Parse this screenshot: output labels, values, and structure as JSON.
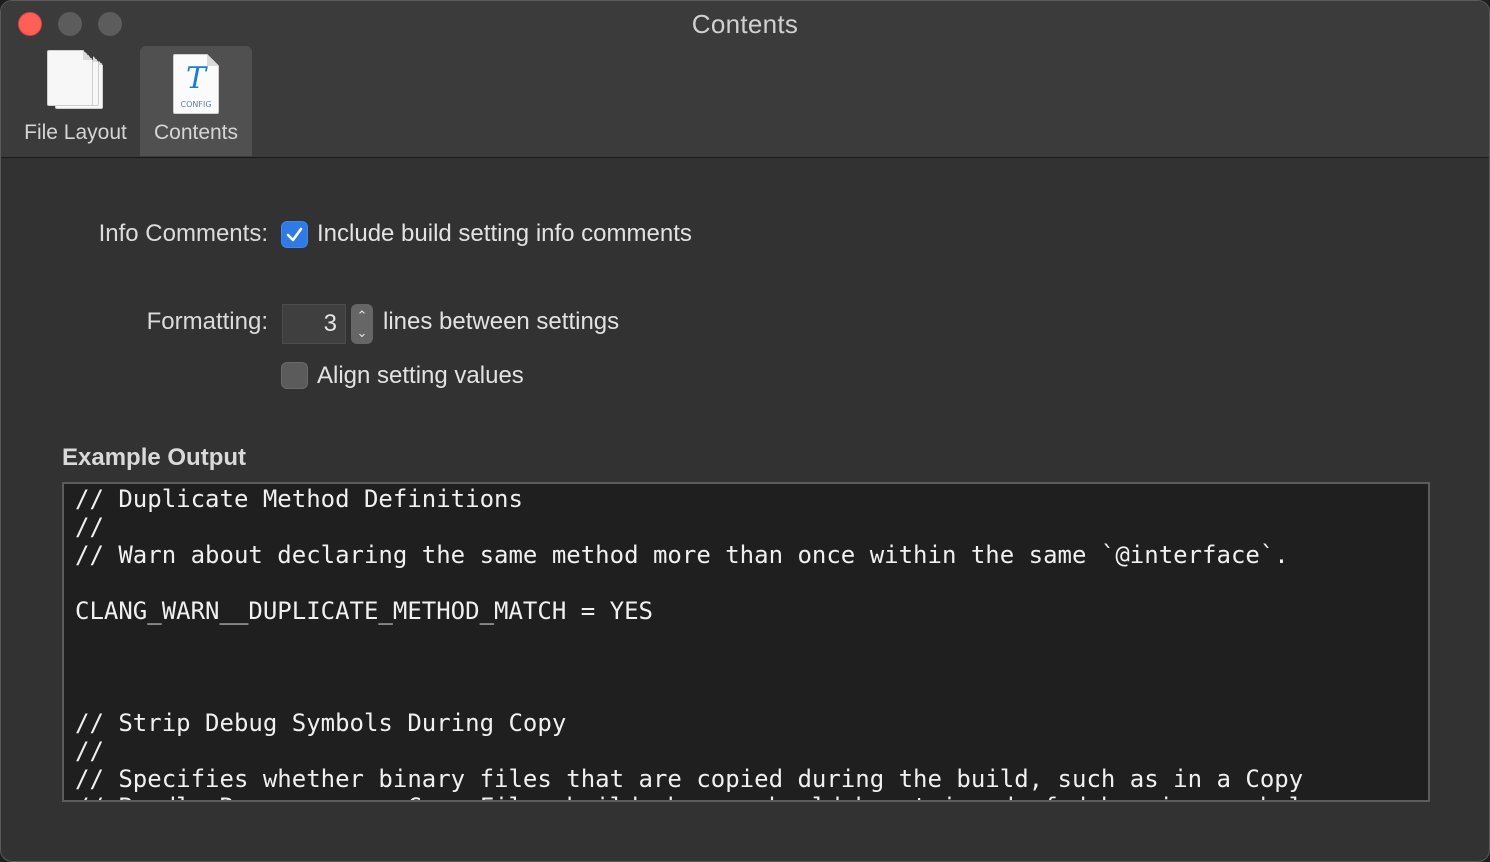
{
  "window": {
    "title": "Contents"
  },
  "toolbar": {
    "tabs": [
      {
        "label": "File Layout",
        "icon": "documents-icon",
        "selected": false
      },
      {
        "label": "Contents",
        "icon": "config-file-icon",
        "selected": true
      }
    ],
    "config_icon_caption": "CONFIG"
  },
  "info_comments": {
    "label": "Info Comments:",
    "checkbox_label": "Include build setting info comments",
    "checked": true
  },
  "formatting": {
    "label": "Formatting:",
    "value": "3",
    "suffix": "lines between settings",
    "align_label": "Align setting values",
    "align_checked": false
  },
  "example_output": {
    "title": "Example Output",
    "lines": [
      "// Duplicate Method Definitions",
      "//",
      "// Warn about declaring the same method more than once within the same `@interface`.",
      "",
      "CLANG_WARN__DUPLICATE_METHOD_MATCH = YES",
      "",
      "",
      "",
      "// Strip Debug Symbols During Copy",
      "//",
      "// Specifies whether binary files that are copied during the build, such as in a Copy",
      "// Bundle Resources or Copy Files build phase, should be stripped of debugging symbols."
    ]
  },
  "colors": {
    "accent": "#2f7ae5",
    "close": "#fe5f57"
  }
}
